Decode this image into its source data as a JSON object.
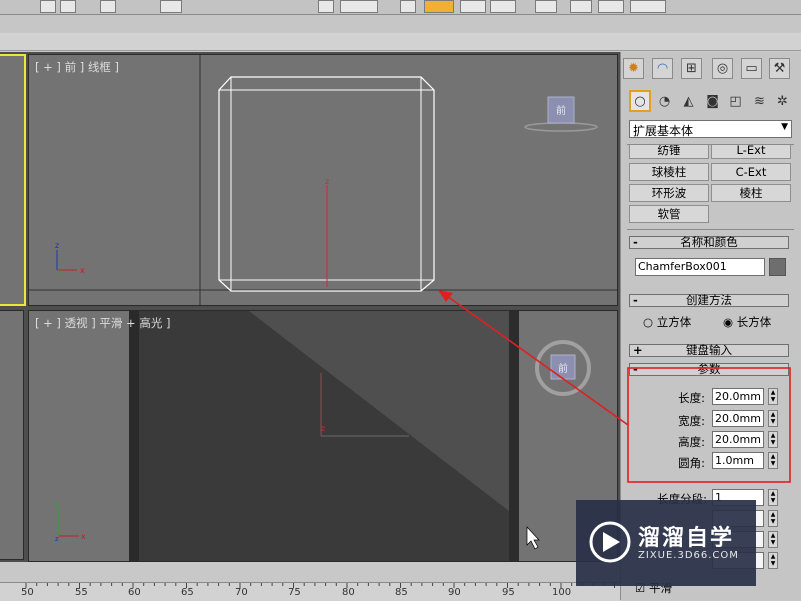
{
  "viewports": {
    "front_label": "[ + ] 前 ] 线框 ]",
    "persp_label": "[ + ] 透视 ] 平滑 + 高光 ]",
    "axis": {
      "x": "x",
      "y": "y",
      "z": "z"
    },
    "viewcube_face": "前"
  },
  "panel": {
    "tab_icons": [
      "create-icon",
      "modify-icon",
      "hierarchy-icon",
      "motion-icon",
      "display-icon",
      "utilities-icon"
    ],
    "category_icons": [
      "geometry-icon",
      "shapes-icon",
      "lights-icon",
      "cameras-icon",
      "helpers-icon",
      "spacewarps-icon",
      "systems-icon"
    ],
    "category_dropdown": "扩展基本体",
    "object_buttons": [
      [
        "纺锤",
        "L-Ext"
      ],
      [
        "球棱柱",
        "C-Ext"
      ],
      [
        "环形波",
        "棱柱"
      ],
      [
        "软管",
        ""
      ]
    ],
    "name_color": {
      "title": "名称和颜色",
      "name_value": "ChamferBox001",
      "swatch": "#6e6e6e"
    },
    "creation_method": {
      "title": "创建方法",
      "options": [
        "立方体",
        "长方体"
      ],
      "selected": "长方体"
    },
    "keyboard_entry": {
      "title": "键盘输入",
      "sign": "+"
    },
    "parameters": {
      "title": "参数",
      "sign": "-",
      "fields": [
        {
          "label": "长度:",
          "value": "20.0mm"
        },
        {
          "label": "宽度:",
          "value": "20.0mm"
        },
        {
          "label": "高度:",
          "value": "20.0mm"
        },
        {
          "label": "圆角:",
          "value": "1.0mm"
        }
      ],
      "segments_label": "长度分段:",
      "segments_value": "1",
      "smooth_label": "平滑"
    }
  },
  "ruler": {
    "numbers": [
      "50",
      "55",
      "60",
      "65",
      "70",
      "75",
      "80",
      "85",
      "90",
      "95",
      "100"
    ]
  },
  "annotation": {
    "highlight_color": "#e02020"
  },
  "watermark": {
    "title": "溜溜自学",
    "url": "ZIXUE.3D66.COM"
  }
}
